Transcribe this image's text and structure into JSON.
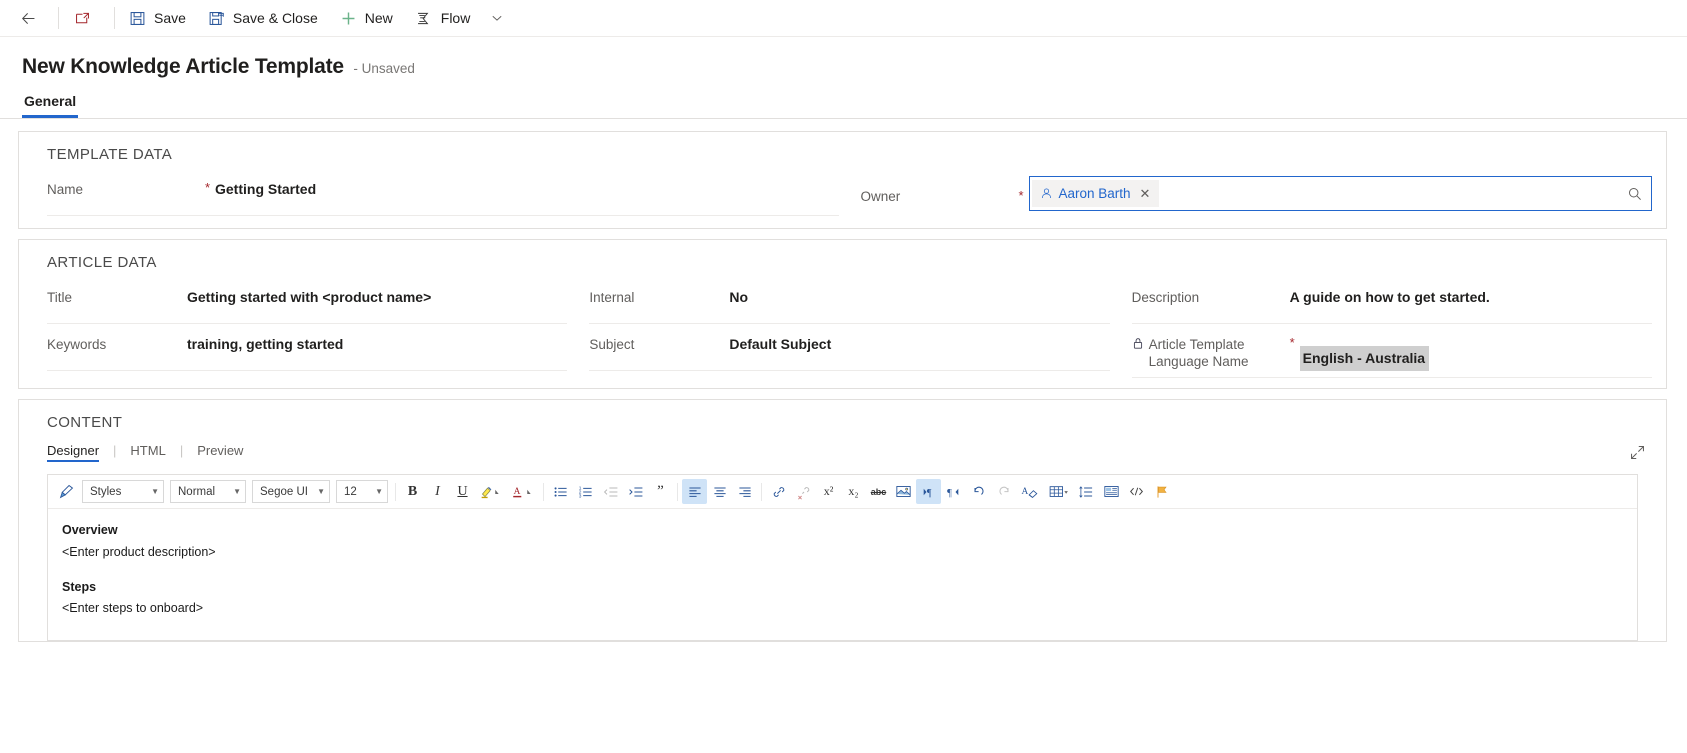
{
  "commandbar": {
    "back_label": "",
    "popout_label": "",
    "save_label": "Save",
    "save_close_label": "Save & Close",
    "new_label": "New",
    "flow_label": "Flow",
    "overflow_label": ""
  },
  "header": {
    "title": "New Knowledge Article Template",
    "subtitle": "- Unsaved",
    "tabs": [
      {
        "label": "General",
        "selected": true
      }
    ]
  },
  "template_data": {
    "section_title": "TEMPLATE DATA",
    "name_label": "Name",
    "name_required": "*",
    "name_value": "Getting Started",
    "owner_label": "Owner",
    "owner_required": "*",
    "owner_value": "Aaron Barth",
    "owner_clear": "✕"
  },
  "article_data": {
    "section_title": "ARTICLE DATA",
    "title_label": "Title",
    "title_value": "Getting started with <product name>",
    "keywords_label": "Keywords",
    "keywords_value": "training, getting started",
    "internal_label": "Internal",
    "internal_value": "No",
    "subject_label": "Subject",
    "subject_value": "Default Subject",
    "description_label": "Description",
    "description_value": "A guide on how to get started.",
    "language_label_line1": "Article Template",
    "language_label_line2": "Language Name",
    "language_required": "*",
    "language_value": "English - Australia"
  },
  "content": {
    "section_title": "CONTENT",
    "tabs": [
      {
        "label": "Designer",
        "selected": true
      },
      {
        "label": "HTML",
        "selected": false
      },
      {
        "label": "Preview",
        "selected": false
      }
    ],
    "tab_divider": "|",
    "expand_icon": "expand-icon",
    "toolbar": {
      "format_painter_icon": "format-painter-icon",
      "styles_value": "Styles",
      "paragraph_value": "Normal",
      "font_value": "Segoe UI",
      "size_value": "12",
      "bold_label": "B",
      "italic_label": "I",
      "underline_label": "U",
      "highlight_label": "highlight-color-icon",
      "fontcolor_label": "font-color-icon",
      "bullets_icon": "bulleted-list-icon",
      "numbering_icon": "numbered-list-icon",
      "outdent_icon": "decrease-indent-icon",
      "indent_icon": "increase-indent-icon",
      "quote_icon": "block-quote-icon",
      "align_left_icon": "align-left-icon",
      "align_center_icon": "align-center-icon",
      "align_right_icon": "align-right-icon",
      "link_icon": "insert-link-icon",
      "unlink_icon": "remove-link-icon",
      "superscript_label": "x²",
      "subscript_label": "x₂",
      "strike_label": "abc",
      "image_icon": "insert-image-icon",
      "ltr_icon": "left-to-right-icon",
      "rtl_icon": "right-to-left-icon",
      "undo_icon": "undo-icon",
      "redo_icon": "redo-icon",
      "clear_format_icon": "clear-formatting-icon",
      "table_icon": "insert-table-icon",
      "line_spacing_icon": "line-spacing-icon",
      "insert_template_icon": "insert-template-icon",
      "source_icon": "source-code-icon",
      "flag_icon": "flag-icon"
    },
    "body": [
      {
        "heading": "Overview",
        "text": "<Enter product description>"
      },
      {
        "heading": "Steps",
        "text": "<Enter steps to onboard>"
      }
    ]
  },
  "colors": {
    "accent": "#2266cc",
    "required": "#a4262c",
    "toolbar_icon": "#2b579a",
    "highlight_bg": "#cfcfcf",
    "new_plus": "#6bb38a"
  }
}
